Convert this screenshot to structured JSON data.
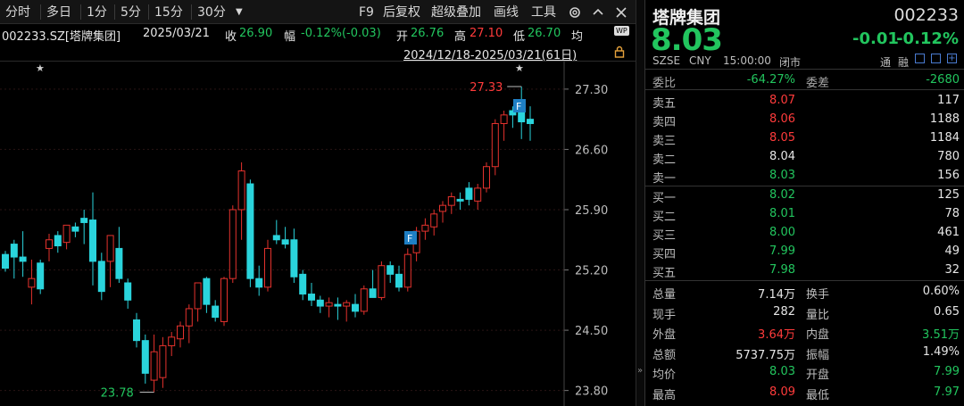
{
  "toolbar": {
    "items": [
      "分时",
      "多日",
      "1分",
      "5分",
      "15分",
      "30分"
    ],
    "dropdown_icon": "caret-down-icon",
    "right_items": [
      "F9",
      "后复权",
      "超级叠加",
      "画线",
      "工具"
    ],
    "settings_icon": "gear-icon",
    "more_icon": "chevron-up-icon",
    "close_icon": "close-icon"
  },
  "info": {
    "code": "002233.SZ[塔牌集团]",
    "date": "2025/03/21",
    "close_label": "收",
    "close_value": "26.90",
    "change_label": "幅",
    "change_value": "-0.12%(-0.03)",
    "open_label": "开",
    "open_value": "26.76",
    "high_label": "高",
    "high_value": "27.10",
    "low_label": "低",
    "low_value": "26.70",
    "avg_label": "均",
    "wp_badge": "WP"
  },
  "range": {
    "text": "2024/12/18-2025/03/21(61日)",
    "lock_icon": "lock-icon"
  },
  "chart_data": {
    "type": "candlestick",
    "y_ticks": [
      "27.30",
      "26.60",
      "25.90",
      "25.20",
      "24.50",
      "23.80"
    ],
    "ylim": [
      23.62,
      27.62
    ],
    "annotations": {
      "high_label": "27.33",
      "low_label": "23.78",
      "event_marker": "F",
      "star_marker": "★"
    },
    "colors": {
      "up": "#e5322d",
      "down": "#2ad4dc",
      "grid": "#2a1414",
      "axis_text": "#bdbdbd"
    },
    "candles": [
      {
        "o": 25.38,
        "h": 25.42,
        "l": 25.18,
        "c": 25.22
      },
      {
        "o": 25.5,
        "h": 25.55,
        "l": 25.1,
        "c": 25.35
      },
      {
        "o": 25.35,
        "h": 25.65,
        "l": 25.12,
        "c": 25.3
      },
      {
        "o": 25.0,
        "h": 25.32,
        "l": 24.8,
        "c": 25.1
      },
      {
        "o": 25.28,
        "h": 25.32,
        "l": 24.92,
        "c": 24.98
      },
      {
        "o": 25.45,
        "h": 25.62,
        "l": 25.3,
        "c": 25.55
      },
      {
        "o": 25.6,
        "h": 25.65,
        "l": 25.4,
        "c": 25.48
      },
      {
        "o": 25.52,
        "h": 25.7,
        "l": 25.44,
        "c": 25.72
      },
      {
        "o": 25.7,
        "h": 25.75,
        "l": 25.58,
        "c": 25.65
      },
      {
        "o": 25.8,
        "h": 25.9,
        "l": 25.5,
        "c": 25.75
      },
      {
        "o": 25.78,
        "h": 26.1,
        "l": 25.02,
        "c": 25.3
      },
      {
        "o": 25.3,
        "h": 25.4,
        "l": 24.85,
        "c": 24.95
      },
      {
        "o": 25.3,
        "h": 25.6,
        "l": 25.0,
        "c": 25.6
      },
      {
        "o": 25.45,
        "h": 25.7,
        "l": 25.05,
        "c": 25.1
      },
      {
        "o": 25.05,
        "h": 25.1,
        "l": 24.75,
        "c": 24.85
      },
      {
        "o": 24.62,
        "h": 24.7,
        "l": 24.3,
        "c": 24.38
      },
      {
        "o": 24.38,
        "h": 24.45,
        "l": 23.88,
        "c": 24.0
      },
      {
        "o": 23.92,
        "h": 24.45,
        "l": 23.78,
        "c": 24.25
      },
      {
        "o": 23.95,
        "h": 24.42,
        "l": 23.83,
        "c": 24.32
      },
      {
        "o": 24.32,
        "h": 24.48,
        "l": 24.2,
        "c": 24.42
      },
      {
        "o": 24.4,
        "h": 24.6,
        "l": 24.3,
        "c": 24.55
      },
      {
        "o": 24.55,
        "h": 24.8,
        "l": 24.35,
        "c": 24.75
      },
      {
        "o": 24.75,
        "h": 25.0,
        "l": 24.6,
        "c": 25.05
      },
      {
        "o": 25.1,
        "h": 25.12,
        "l": 24.7,
        "c": 24.8
      },
      {
        "o": 24.78,
        "h": 24.85,
        "l": 24.6,
        "c": 24.65
      },
      {
        "o": 24.6,
        "h": 25.12,
        "l": 24.55,
        "c": 25.1
      },
      {
        "o": 25.1,
        "h": 25.95,
        "l": 25.05,
        "c": 25.9
      },
      {
        "o": 25.9,
        "h": 26.45,
        "l": 25.55,
        "c": 26.35
      },
      {
        "o": 26.2,
        "h": 26.25,
        "l": 25.0,
        "c": 25.1
      },
      {
        "o": 25.1,
        "h": 25.25,
        "l": 24.9,
        "c": 25.0
      },
      {
        "o": 25.0,
        "h": 25.55,
        "l": 24.95,
        "c": 25.45
      },
      {
        "o": 25.6,
        "h": 25.78,
        "l": 25.5,
        "c": 25.55
      },
      {
        "o": 25.55,
        "h": 25.7,
        "l": 25.45,
        "c": 25.5
      },
      {
        "o": 25.55,
        "h": 25.68,
        "l": 25.05,
        "c": 25.12
      },
      {
        "o": 25.15,
        "h": 25.2,
        "l": 24.85,
        "c": 24.92
      },
      {
        "o": 24.92,
        "h": 25.05,
        "l": 24.78,
        "c": 24.85
      },
      {
        "o": 24.85,
        "h": 24.9,
        "l": 24.7,
        "c": 24.78
      },
      {
        "o": 24.78,
        "h": 24.88,
        "l": 24.65,
        "c": 24.82
      },
      {
        "o": 24.8,
        "h": 24.88,
        "l": 24.62,
        "c": 24.78
      },
      {
        "o": 24.78,
        "h": 24.85,
        "l": 24.6,
        "c": 24.82
      },
      {
        "o": 24.8,
        "h": 24.92,
        "l": 24.65,
        "c": 24.72
      },
      {
        "o": 24.72,
        "h": 25.02,
        "l": 24.68,
        "c": 24.98
      },
      {
        "o": 24.98,
        "h": 25.2,
        "l": 24.9,
        "c": 24.88
      },
      {
        "o": 24.88,
        "h": 25.3,
        "l": 24.85,
        "c": 25.25
      },
      {
        "o": 25.25,
        "h": 25.3,
        "l": 25.05,
        "c": 25.15
      },
      {
        "o": 25.15,
        "h": 25.25,
        "l": 24.95,
        "c": 25.0
      },
      {
        "o": 25.0,
        "h": 25.45,
        "l": 24.95,
        "c": 25.38
      },
      {
        "o": 25.4,
        "h": 25.7,
        "l": 25.3,
        "c": 25.65
      },
      {
        "o": 25.65,
        "h": 25.8,
        "l": 25.55,
        "c": 25.72
      },
      {
        "o": 25.7,
        "h": 25.9,
        "l": 25.6,
        "c": 25.85
      },
      {
        "o": 25.88,
        "h": 26.0,
        "l": 25.75,
        "c": 25.95
      },
      {
        "o": 25.95,
        "h": 26.1,
        "l": 25.85,
        "c": 26.05
      },
      {
        "o": 26.02,
        "h": 26.1,
        "l": 25.9,
        "c": 26.0
      },
      {
        "o": 26.15,
        "h": 26.22,
        "l": 25.95,
        "c": 26.02
      },
      {
        "o": 26.0,
        "h": 26.2,
        "l": 25.9,
        "c": 26.15
      },
      {
        "o": 26.15,
        "h": 26.45,
        "l": 26.1,
        "c": 26.4
      },
      {
        "o": 26.4,
        "h": 26.95,
        "l": 26.3,
        "c": 26.9
      },
      {
        "o": 26.9,
        "h": 27.05,
        "l": 26.7,
        "c": 27.0
      },
      {
        "o": 27.05,
        "h": 27.1,
        "l": 26.85,
        "c": 27.0
      },
      {
        "o": 27.12,
        "h": 27.33,
        "l": 26.72,
        "c": 26.92
      },
      {
        "o": 26.95,
        "h": 27.1,
        "l": 26.7,
        "c": 26.9
      }
    ]
  },
  "panel": {
    "name": "塔牌集团",
    "code": "002233",
    "price": "8.03",
    "change": "-0.01",
    "change_pct": "-0.12%",
    "meta": [
      "SZSE",
      "CNY",
      "15:00:00",
      "闭市"
    ],
    "meta_right": [
      "通",
      "融"
    ],
    "ratio_label": "委比",
    "ratio_value": "-64.27%",
    "diff_label": "委差",
    "diff_value": "-2680",
    "asks": [
      {
        "label": "卖五",
        "price": "8.07",
        "vol": "117",
        "color": "#ff3b3b"
      },
      {
        "label": "卖四",
        "price": "8.06",
        "vol": "1188",
        "color": "#ff3b3b"
      },
      {
        "label": "卖三",
        "price": "8.05",
        "vol": "1184",
        "color": "#ff3b3b"
      },
      {
        "label": "卖二",
        "price": "8.04",
        "vol": "780",
        "color": "#e6e6e6"
      },
      {
        "label": "卖一",
        "price": "8.03",
        "vol": "156",
        "color": "#22c55e"
      }
    ],
    "bids": [
      {
        "label": "买一",
        "price": "8.02",
        "vol": "125",
        "color": "#22c55e"
      },
      {
        "label": "买二",
        "price": "8.01",
        "vol": "78",
        "color": "#22c55e"
      },
      {
        "label": "买三",
        "price": "8.00",
        "vol": "461",
        "color": "#22c55e"
      },
      {
        "label": "买四",
        "price": "7.99",
        "vol": "49",
        "color": "#22c55e"
      },
      {
        "label": "买五",
        "price": "7.98",
        "vol": "32",
        "color": "#22c55e"
      }
    ],
    "stats": [
      {
        "l1": "总量",
        "v1": "7.14万",
        "c1": "#e6e6e6",
        "l2": "换手",
        "v2": "0.60%",
        "c2": "#e6e6e6"
      },
      {
        "l1": "现手",
        "v1": "282",
        "c1": "#e6e6e6",
        "l2": "量比",
        "v2": "0.65",
        "c2": "#e6e6e6"
      },
      {
        "l1": "外盘",
        "v1": "3.64万",
        "c1": "#ff3b3b",
        "l2": "内盘",
        "v2": "3.51万",
        "c2": "#22c55e"
      },
      {
        "l1": "总额",
        "v1": "5737.75万",
        "c1": "#e6e6e6",
        "l2": "振幅",
        "v2": "1.49%",
        "c2": "#e6e6e6"
      },
      {
        "l1": "均价",
        "v1": "8.03",
        "c1": "#22c55e",
        "l2": "开盘",
        "v2": "7.99",
        "c2": "#22c55e"
      },
      {
        "l1": "最高",
        "v1": "8.09",
        "c1": "#ff3b3b",
        "l2": "最低",
        "v2": "7.97",
        "c2": "#22c55e"
      }
    ]
  }
}
